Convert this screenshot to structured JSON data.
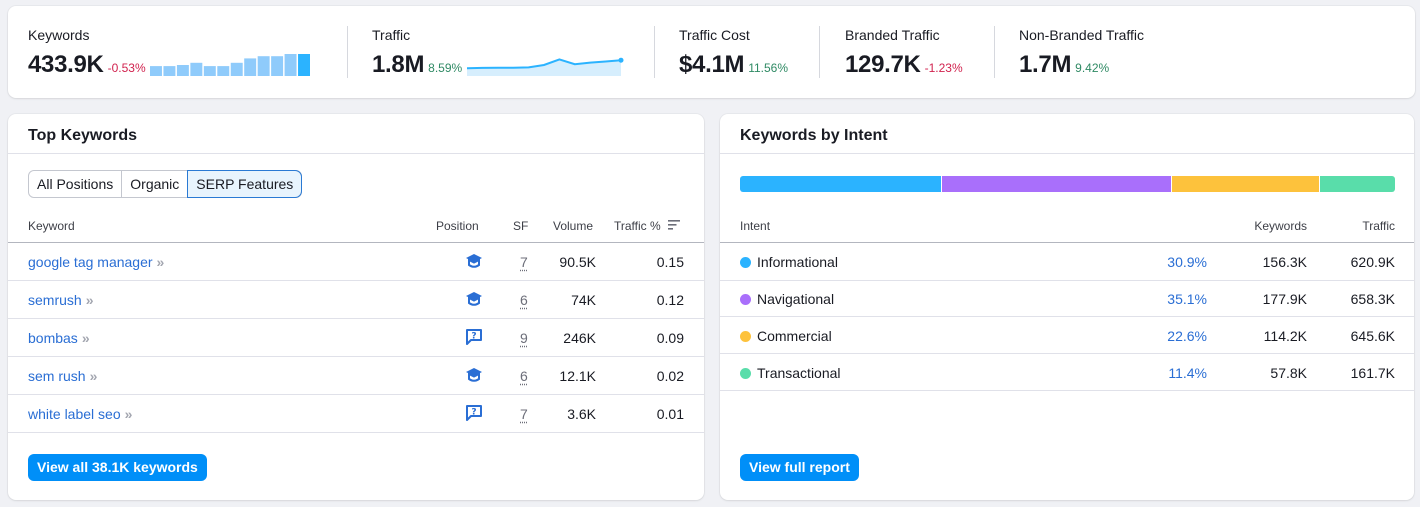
{
  "summary": {
    "metrics": [
      {
        "label": "Keywords",
        "value": "433.9K",
        "delta": "-0.53%",
        "trend": "negative"
      },
      {
        "label": "Traffic",
        "value": "1.8M",
        "delta": "8.59%",
        "trend": "positive"
      },
      {
        "label": "Traffic Cost",
        "value": "$4.1M",
        "delta": "11.56%",
        "trend": "positive"
      },
      {
        "label": "Branded Traffic",
        "value": "129.7K",
        "delta": "-1.23%",
        "trend": "negative"
      },
      {
        "label": "Non-Branded Traffic",
        "value": "1.7M",
        "delta": "9.42%",
        "trend": "positive"
      }
    ],
    "keywords_sparkbars": [
      0.45,
      0.45,
      0.5,
      0.6,
      0.45,
      0.45,
      0.6,
      0.8,
      0.9,
      0.9,
      1.0,
      1.0
    ],
    "traffic_sparkline": [
      0.3,
      0.32,
      0.33,
      0.33,
      0.35,
      0.5,
      0.85,
      0.55,
      0.65,
      0.72,
      0.8
    ],
    "colors": {
      "negative": "#d1224e",
      "positive": "#2f8a64",
      "spark_bar": "#8fcbfb",
      "spark_bar_last": "#2bb3ff",
      "spark_line": "#2bb3ff",
      "spark_fill": "#d6eefd"
    }
  },
  "top_keywords": {
    "title": "Top Keywords",
    "tabs": [
      {
        "label": "All Positions",
        "active": false
      },
      {
        "label": "Organic",
        "active": false
      },
      {
        "label": "SERP Features",
        "active": true
      }
    ],
    "columns": {
      "keyword": "Keyword",
      "position": "Position",
      "sf": "SF",
      "volume": "Volume",
      "traffic": "Traffic %"
    },
    "sort_icon": "sort-descending-icon",
    "rows": [
      {
        "keyword": "google tag manager",
        "position_icon": "graduation-cap-icon",
        "sf": "7",
        "volume": "90.5K",
        "traffic": "0.15"
      },
      {
        "keyword": "semrush",
        "position_icon": "graduation-cap-icon",
        "sf": "6",
        "volume": "74K",
        "traffic": "0.12"
      },
      {
        "keyword": "bombas",
        "position_icon": "question-bubble-icon",
        "sf": "9",
        "volume": "246K",
        "traffic": "0.09"
      },
      {
        "keyword": "sem rush",
        "position_icon": "graduation-cap-icon",
        "sf": "6",
        "volume": "12.1K",
        "traffic": "0.02"
      },
      {
        "keyword": "white label seo",
        "position_icon": "question-bubble-icon",
        "sf": "7",
        "volume": "3.6K",
        "traffic": "0.01"
      }
    ],
    "chevron": "»",
    "view_all_label": "View all 38.1K keywords"
  },
  "keywords_by_intent": {
    "title": "Keywords by Intent",
    "columns": {
      "intent": "Intent",
      "keywords": "Keywords",
      "traffic": "Traffic"
    },
    "rows": [
      {
        "intent": "Informational",
        "share": "30.9%",
        "share_value": 30.9,
        "keywords": "156.3K",
        "traffic": "620.9K",
        "color": "#2bb3ff"
      },
      {
        "intent": "Navigational",
        "share": "35.1%",
        "share_value": 35.1,
        "keywords": "177.9K",
        "traffic": "658.3K",
        "color": "#a96ffb"
      },
      {
        "intent": "Commercial",
        "share": "22.6%",
        "share_value": 22.6,
        "keywords": "114.2K",
        "traffic": "645.6K",
        "color": "#fdc23c"
      },
      {
        "intent": "Transactional",
        "share": "11.4%",
        "share_value": 11.4,
        "keywords": "57.8K",
        "traffic": "161.7K",
        "color": "#59ddaa"
      }
    ],
    "view_report_label": "View full report"
  }
}
